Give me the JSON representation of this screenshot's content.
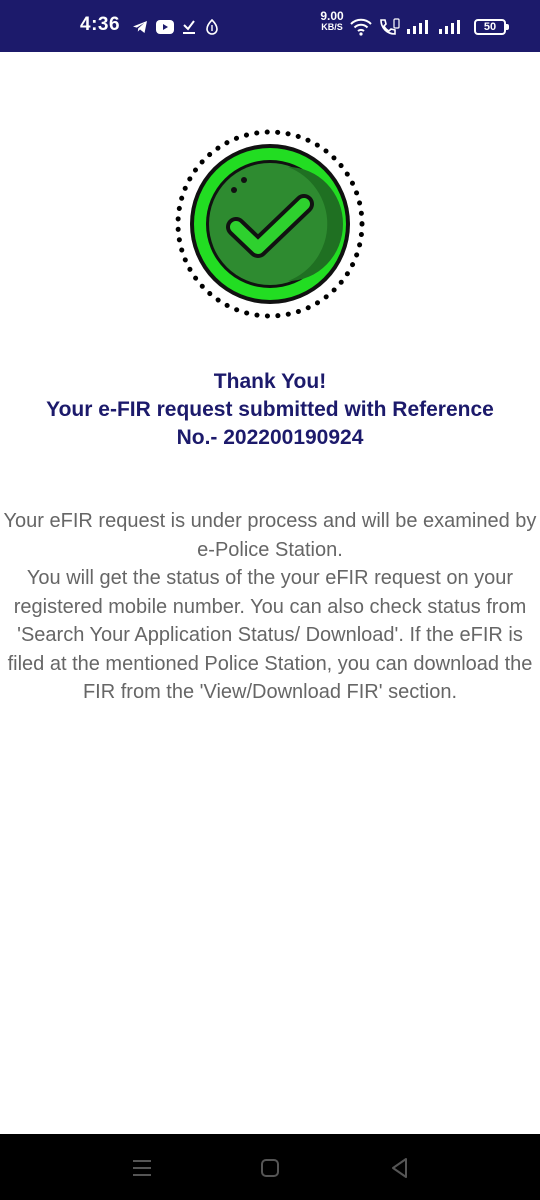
{
  "status_bar": {
    "time": "4:36",
    "net_speed_value": "9.00",
    "net_speed_unit": "KB/S",
    "battery": "50",
    "background": "#1c1a6b",
    "icons_left": [
      "telegram-icon",
      "youtube-icon",
      "download-done-icon",
      "app-notification-icon"
    ],
    "icons_right": [
      "wifi-icon",
      "volte-call-icon",
      "signal-icon",
      "signal-icon"
    ]
  },
  "success": {
    "icon": "checkmark-badge-icon",
    "colors": {
      "ring": "#22dd22",
      "fill": "#2e8b30",
      "outline": "#111111"
    }
  },
  "headline": {
    "line1": "Thank You!",
    "line2": "Your e-FIR request submitted with Reference",
    "line3": "No.- 202200190924",
    "color": "#1c1a6b"
  },
  "message": {
    "paragraph1": "Your eFIR request is under process and will be examined by e-Police Station.",
    "paragraph2": "You will get the status of the your eFIR request on your registered mobile number. You can also check status from 'Search Your Application Status/ Download'. If the eFIR is filed at the mentioned Police Station, you can download the FIR from the 'View/Download FIR' section.",
    "color": "#666666"
  },
  "nav_bar": {
    "buttons": [
      "menu-icon",
      "home-icon",
      "back-icon"
    ]
  }
}
